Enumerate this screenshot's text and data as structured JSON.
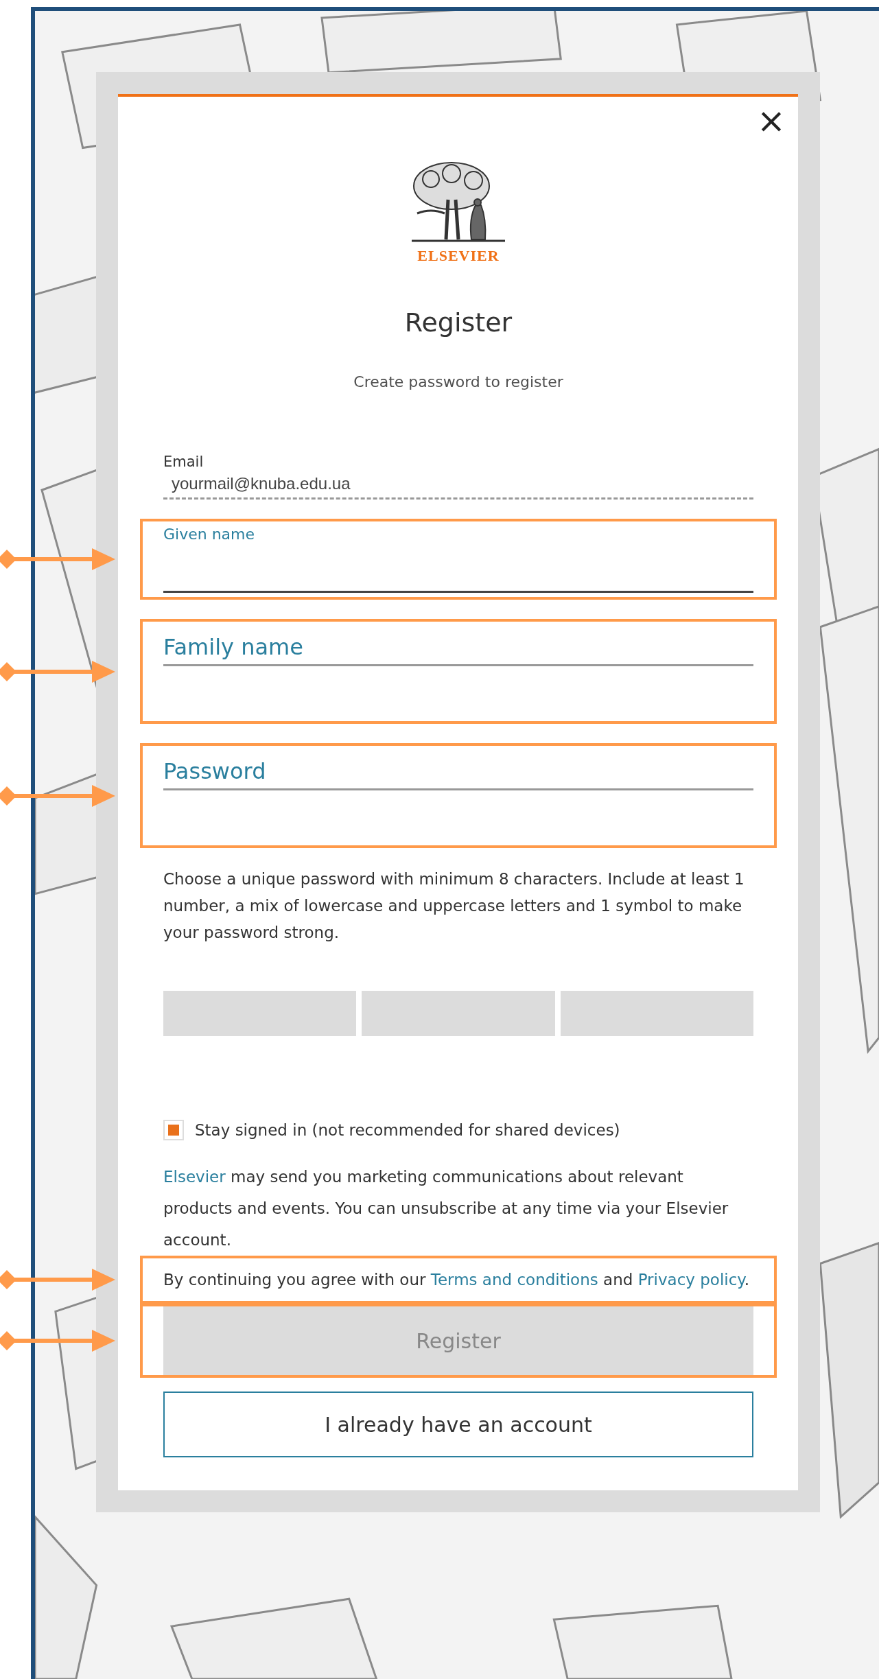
{
  "dialog": {
    "close_label": "×",
    "brand": "ELSEVIER",
    "title": "Register",
    "subtitle": "Create password to register"
  },
  "fields": [
    {
      "kind": "readonly",
      "label": "Email",
      "value": "yourmail@knuba.edu.ua"
    },
    {
      "kind": "input",
      "label": "Given name",
      "focused": true,
      "highlighted": true
    },
    {
      "kind": "input",
      "label": "Family name",
      "focused": false,
      "highlighted": true
    },
    {
      "kind": "input",
      "label": "Password",
      "focused": false,
      "highlighted": true
    }
  ],
  "password_hint": "Choose a unique password with minimum 8 characters. Include at least 1 number, a mix of lowercase and uppercase letters and 1 symbol to make your password strong.",
  "stay_signed_in": {
    "label": "Stay signed in (not recommended for shared devices)",
    "checked": true
  },
  "marketing": {
    "link": "Elsevier",
    "text": "may send you marketing communications about relevant products and events. You can unsubscribe at any time via your Elsevier account."
  },
  "consent": {
    "before": "By continuing you agree with our",
    "terms_link": "Terms and conditions",
    "middle": "and",
    "privacy_link": "Privacy policy",
    "after": ".",
    "highlighted": true
  },
  "register_button": {
    "label": "Register",
    "disabled": true,
    "highlighted": true
  },
  "login_button": {
    "label": "I already have an account"
  }
}
